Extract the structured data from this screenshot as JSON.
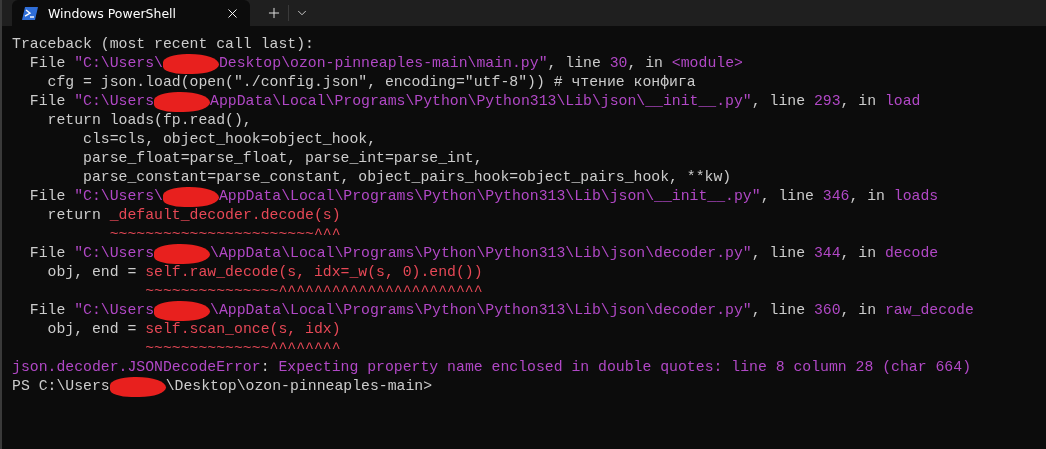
{
  "tabs": [
    {
      "title": "Windows PowerShell",
      "selected": true
    }
  ],
  "terminal": {
    "lines": [
      [
        {
          "kind": "plain",
          "text": "Traceback (most recent call last):"
        }
      ],
      [
        {
          "kind": "plain",
          "text": "  File "
        },
        {
          "kind": "accent",
          "text": "\"C:\\Users\\"
        },
        {
          "kind": "redaction"
        },
        {
          "kind": "accent",
          "text": "Desktop\\ozon-pinneaples-main\\main.py\""
        },
        {
          "kind": "plain",
          "text": ", line "
        },
        {
          "kind": "accent",
          "text": "30"
        },
        {
          "kind": "plain",
          "text": ", in "
        },
        {
          "kind": "accent",
          "text": "<module>"
        }
      ],
      [
        {
          "kind": "plain",
          "text": "    cfg = json.load(open(\"./config.json\", encoding=\"utf-8\")) # чтение конфига"
        }
      ],
      [
        {
          "kind": "plain",
          "text": "  File "
        },
        {
          "kind": "accent",
          "text": "\"C:\\Users"
        },
        {
          "kind": "redaction"
        },
        {
          "kind": "accent",
          "text": "AppData\\Local\\Programs\\Python\\Python313\\Lib\\json\\__init__.py\""
        },
        {
          "kind": "plain",
          "text": ", line "
        },
        {
          "kind": "accent",
          "text": "293"
        },
        {
          "kind": "plain",
          "text": ", in "
        },
        {
          "kind": "accent",
          "text": "load"
        }
      ],
      [
        {
          "kind": "plain",
          "text": "    return loads(fp.read(),"
        }
      ],
      [
        {
          "kind": "plain",
          "text": "        cls=cls, object_hook=object_hook,"
        }
      ],
      [
        {
          "kind": "plain",
          "text": "        parse_float=parse_float, parse_int=parse_int,"
        }
      ],
      [
        {
          "kind": "plain",
          "text": "        parse_constant=parse_constant, object_pairs_hook=object_pairs_hook, **kw)"
        }
      ],
      [
        {
          "kind": "plain",
          "text": "  File "
        },
        {
          "kind": "accent",
          "text": "\"C:\\Users\\"
        },
        {
          "kind": "redaction"
        },
        {
          "kind": "accent",
          "text": "AppData\\Local\\Programs\\Python\\Python313\\Lib\\json\\__init__.py\""
        },
        {
          "kind": "plain",
          "text": ", line "
        },
        {
          "kind": "accent",
          "text": "346"
        },
        {
          "kind": "plain",
          "text": ", in "
        },
        {
          "kind": "accent",
          "text": "loads"
        }
      ],
      [
        {
          "kind": "plain",
          "text": "    return "
        },
        {
          "kind": "error",
          "text": "_default_decoder.decode(s)"
        }
      ],
      [
        {
          "kind": "marker",
          "text": "~~~~~~~~~~~~~~~~~~~~~~~^^^"
        }
      ],
      [
        {
          "kind": "plain",
          "text": "  File "
        },
        {
          "kind": "accent",
          "text": "\"C:\\Users"
        },
        {
          "kind": "redaction"
        },
        {
          "kind": "accent",
          "text": "\\AppData\\Local\\Programs\\Python\\Python313\\Lib\\json\\decoder.py\""
        },
        {
          "kind": "plain",
          "text": ", line "
        },
        {
          "kind": "accent",
          "text": "344"
        },
        {
          "kind": "plain",
          "text": ", in "
        },
        {
          "kind": "accent",
          "text": "decode"
        }
      ],
      [
        {
          "kind": "plain",
          "text": "    obj, end = "
        },
        {
          "kind": "error",
          "text": "self.raw_decode(s, idx=_w(s, 0).end())"
        }
      ],
      [
        {
          "kind": "marker",
          "text": "~~~~~~~~~~~~~~~^^^^^^^^^^^^^^^^^^^^^^^"
        }
      ],
      [
        {
          "kind": "plain",
          "text": "  File "
        },
        {
          "kind": "accent",
          "text": "\"C:\\Users"
        },
        {
          "kind": "redaction"
        },
        {
          "kind": "accent",
          "text": "\\AppData\\Local\\Programs\\Python\\Python313\\Lib\\json\\decoder.py\""
        },
        {
          "kind": "plain",
          "text": ", line "
        },
        {
          "kind": "accent",
          "text": "360"
        },
        {
          "kind": "plain",
          "text": ", in "
        },
        {
          "kind": "accent",
          "text": "raw_decode"
        }
      ],
      [
        {
          "kind": "plain",
          "text": "    obj, end = "
        },
        {
          "kind": "error",
          "text": "self.scan_once(s, idx)"
        }
      ],
      [
        {
          "kind": "marker",
          "text": "~~~~~~~~~~~~~~^^^^^^^^"
        }
      ],
      [
        {
          "kind": "accent",
          "text": "json.decoder.JSONDecodeError"
        },
        {
          "kind": "plain",
          "text": ": "
        },
        {
          "kind": "accent",
          "text": "Expecting property name enclosed in double quotes: line 8 column 28 (char 664)"
        }
      ],
      [
        {
          "kind": "plain",
          "text": "PS C:\\Users"
        },
        {
          "kind": "redaction"
        },
        {
          "kind": "plain",
          "text": "\\Desktop\\ozon-pinneaples-main>"
        }
      ]
    ]
  }
}
